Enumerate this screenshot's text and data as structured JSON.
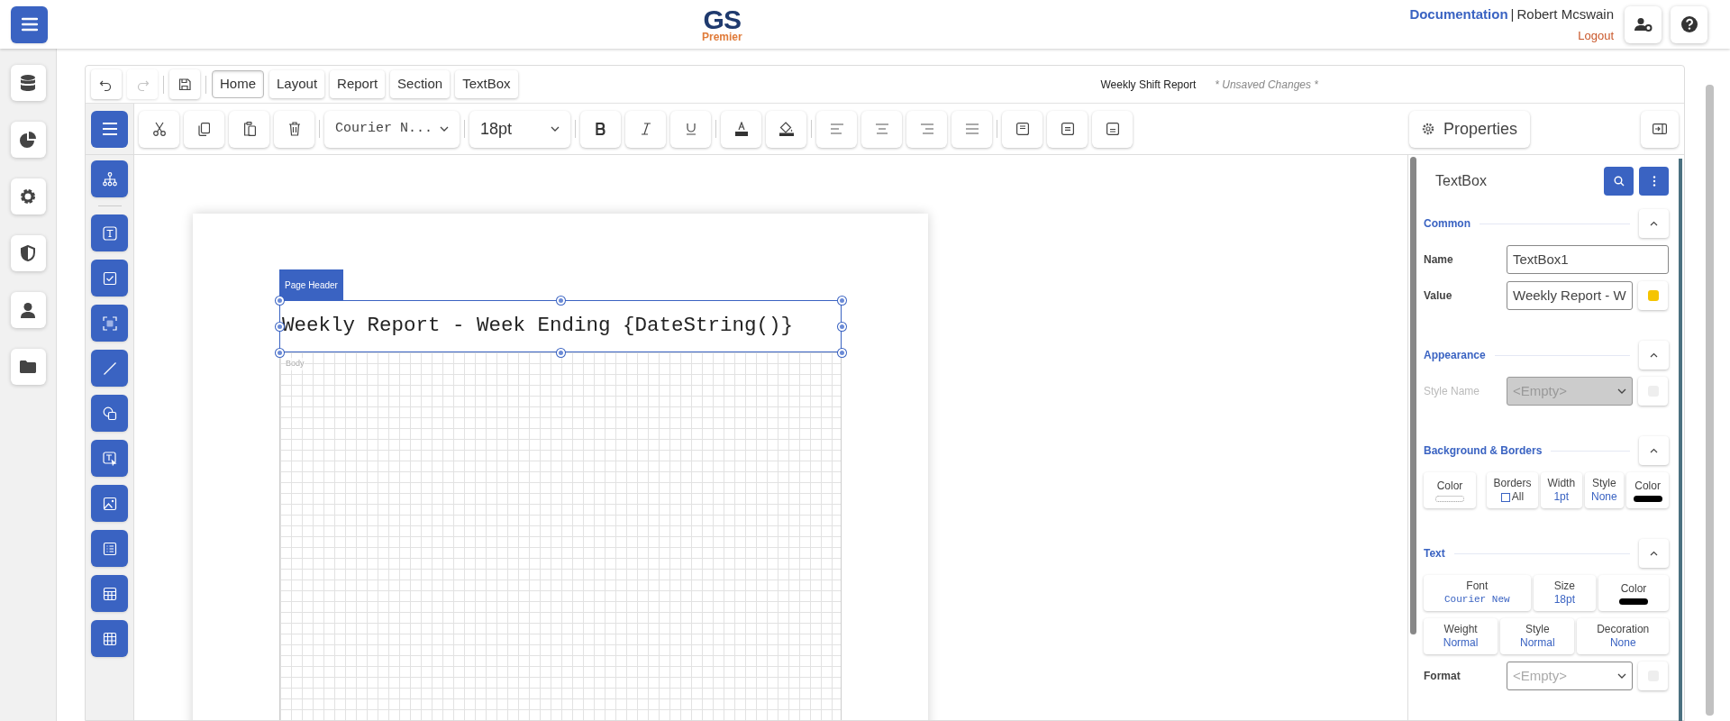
{
  "logo": {
    "title": "GS",
    "subtitle": "Premier"
  },
  "user": {
    "documentation": "Documentation",
    "separator": "|",
    "name": "Robert Mcswain",
    "logout": "Logout"
  },
  "designer": {
    "history": [
      {
        "kind": "undo",
        "disabled": false
      },
      {
        "kind": "redo",
        "disabled": true
      }
    ],
    "tabs": [
      {
        "label": "Home",
        "selected": true
      },
      {
        "label": "Layout",
        "selected": false
      },
      {
        "label": "Report",
        "selected": false
      },
      {
        "label": "Section",
        "selected": false
      },
      {
        "label": "TextBox",
        "selected": false
      }
    ],
    "report_title": "Weekly Shift Report",
    "unsaved": "* Unsaved Changes *",
    "font_select": "Courier N...",
    "size_select": "18pt",
    "properties_button": "Properties"
  },
  "canvas": {
    "section_tag": "Page Header",
    "textbox_text": "Weekly Report - Week Ending {DateString()}",
    "body_label": "Body"
  },
  "properties": {
    "title": "TextBox",
    "sections": [
      {
        "title": "Common",
        "items": [
          {
            "kind": "input",
            "label": "Name",
            "value": "TextBox1",
            "disabled": false
          },
          {
            "kind": "input",
            "label": "Value",
            "value": "Weekly Report - W",
            "disabled": false,
            "expression": true
          }
        ]
      },
      {
        "title": "Appearance",
        "items": [
          {
            "kind": "select",
            "label": "Style Name",
            "placeholder": "<Empty>",
            "disabled": true,
            "expression": false
          }
        ]
      },
      {
        "title": "Background & Borders",
        "items": [
          {
            "kind": "cells",
            "cells": [
              {
                "kind": "swatch",
                "label": "Color"
              },
              {
                "kind": "checkbox",
                "label": "Borders",
                "value": "All",
                "checked": false
              },
              {
                "kind": "text",
                "label": "Width",
                "value": "1pt"
              },
              {
                "kind": "text",
                "label": "Style",
                "value": "None"
              },
              {
                "kind": "swatch",
                "label": "Color",
                "color": "#000000"
              }
            ]
          }
        ]
      },
      {
        "title": "Text",
        "items": [
          {
            "kind": "cells",
            "cells": [
              {
                "kind": "font",
                "label": "Font",
                "value": "Courier New"
              },
              {
                "kind": "text",
                "label": "Size",
                "value": "18pt"
              },
              {
                "kind": "swatch",
                "label": "Color",
                "color": "#000000"
              }
            ]
          },
          {
            "kind": "cells",
            "cells": [
              {
                "kind": "text",
                "label": "Weight",
                "value": "Normal"
              },
              {
                "kind": "text",
                "label": "Style",
                "value": "Normal"
              },
              {
                "kind": "text",
                "label": "Decoration",
                "value": "None"
              }
            ]
          },
          {
            "kind": "select",
            "label": "Format",
            "placeholder": "<Empty>",
            "disabled": false,
            "expression": false
          }
        ]
      }
    ]
  }
}
